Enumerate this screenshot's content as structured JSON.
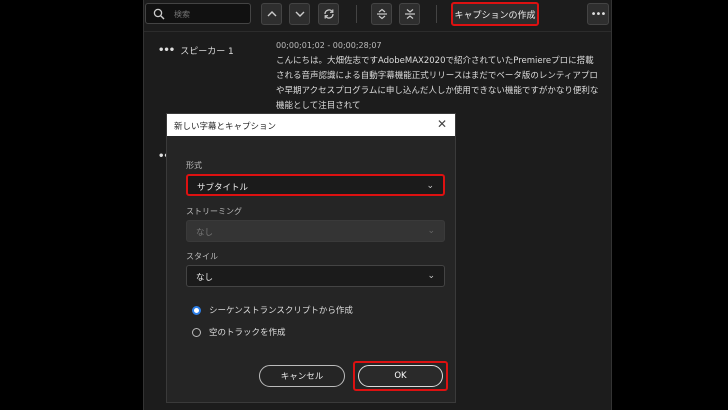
{
  "toolbar": {
    "search_placeholder": "検索",
    "create_caption_label": "キャプションの作成"
  },
  "transcript": {
    "speaker": "スピーカー 1",
    "timecode": "00;00;01;02 - 00;00;28;07",
    "text": "こんにちは。大畑佐志ですAdobeMAX2020で紹介されていたPremiereプロに搭載される音声認識による自動字幕機能正式リリースはまだでベータ版のレンティアプロや早期アクセスプログラムに申し込んだ人しか使用できない機能ですがかなり便利な機能として注目されて"
  },
  "dialog": {
    "title": "新しい字幕とキャプション",
    "format_label": "形式",
    "format_value": "サブタイトル",
    "streaming_label": "ストリーミング",
    "streaming_value": "なし",
    "style_label": "スタイル",
    "style_value": "なし",
    "radio_options": [
      {
        "label": "シーケンストランスクリプトから作成",
        "selected": true
      },
      {
        "label": "空のトラックを作成",
        "selected": false
      }
    ],
    "cancel_label": "キャンセル",
    "ok_label": "OK"
  },
  "colors": {
    "highlight": "#dd1111",
    "radio_selected": "#2d7fe8"
  }
}
